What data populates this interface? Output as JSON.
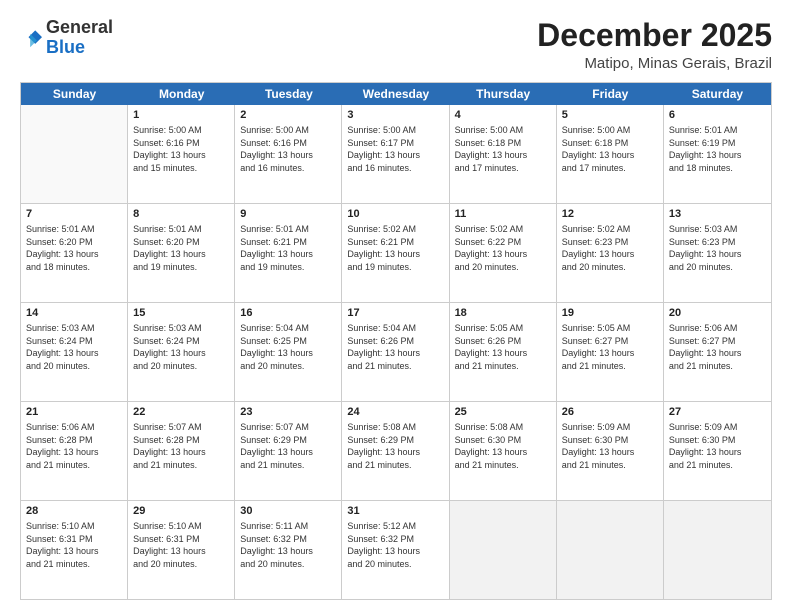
{
  "header": {
    "logo": {
      "general": "General",
      "blue": "Blue"
    },
    "title": "December 2025",
    "subtitle": "Matipo, Minas Gerais, Brazil"
  },
  "weekdays": [
    "Sunday",
    "Monday",
    "Tuesday",
    "Wednesday",
    "Thursday",
    "Friday",
    "Saturday"
  ],
  "rows": [
    [
      {
        "day": "",
        "info": "",
        "empty": true
      },
      {
        "day": "1",
        "info": "Sunrise: 5:00 AM\nSunset: 6:16 PM\nDaylight: 13 hours\nand 15 minutes."
      },
      {
        "day": "2",
        "info": "Sunrise: 5:00 AM\nSunset: 6:16 PM\nDaylight: 13 hours\nand 16 minutes."
      },
      {
        "day": "3",
        "info": "Sunrise: 5:00 AM\nSunset: 6:17 PM\nDaylight: 13 hours\nand 16 minutes."
      },
      {
        "day": "4",
        "info": "Sunrise: 5:00 AM\nSunset: 6:18 PM\nDaylight: 13 hours\nand 17 minutes."
      },
      {
        "day": "5",
        "info": "Sunrise: 5:00 AM\nSunset: 6:18 PM\nDaylight: 13 hours\nand 17 minutes."
      },
      {
        "day": "6",
        "info": "Sunrise: 5:01 AM\nSunset: 6:19 PM\nDaylight: 13 hours\nand 18 minutes."
      }
    ],
    [
      {
        "day": "7",
        "info": "Sunrise: 5:01 AM\nSunset: 6:20 PM\nDaylight: 13 hours\nand 18 minutes."
      },
      {
        "day": "8",
        "info": "Sunrise: 5:01 AM\nSunset: 6:20 PM\nDaylight: 13 hours\nand 19 minutes."
      },
      {
        "day": "9",
        "info": "Sunrise: 5:01 AM\nSunset: 6:21 PM\nDaylight: 13 hours\nand 19 minutes."
      },
      {
        "day": "10",
        "info": "Sunrise: 5:02 AM\nSunset: 6:21 PM\nDaylight: 13 hours\nand 19 minutes."
      },
      {
        "day": "11",
        "info": "Sunrise: 5:02 AM\nSunset: 6:22 PM\nDaylight: 13 hours\nand 20 minutes."
      },
      {
        "day": "12",
        "info": "Sunrise: 5:02 AM\nSunset: 6:23 PM\nDaylight: 13 hours\nand 20 minutes."
      },
      {
        "day": "13",
        "info": "Sunrise: 5:03 AM\nSunset: 6:23 PM\nDaylight: 13 hours\nand 20 minutes."
      }
    ],
    [
      {
        "day": "14",
        "info": "Sunrise: 5:03 AM\nSunset: 6:24 PM\nDaylight: 13 hours\nand 20 minutes."
      },
      {
        "day": "15",
        "info": "Sunrise: 5:03 AM\nSunset: 6:24 PM\nDaylight: 13 hours\nand 20 minutes."
      },
      {
        "day": "16",
        "info": "Sunrise: 5:04 AM\nSunset: 6:25 PM\nDaylight: 13 hours\nand 20 minutes."
      },
      {
        "day": "17",
        "info": "Sunrise: 5:04 AM\nSunset: 6:26 PM\nDaylight: 13 hours\nand 21 minutes."
      },
      {
        "day": "18",
        "info": "Sunrise: 5:05 AM\nSunset: 6:26 PM\nDaylight: 13 hours\nand 21 minutes."
      },
      {
        "day": "19",
        "info": "Sunrise: 5:05 AM\nSunset: 6:27 PM\nDaylight: 13 hours\nand 21 minutes."
      },
      {
        "day": "20",
        "info": "Sunrise: 5:06 AM\nSunset: 6:27 PM\nDaylight: 13 hours\nand 21 minutes."
      }
    ],
    [
      {
        "day": "21",
        "info": "Sunrise: 5:06 AM\nSunset: 6:28 PM\nDaylight: 13 hours\nand 21 minutes."
      },
      {
        "day": "22",
        "info": "Sunrise: 5:07 AM\nSunset: 6:28 PM\nDaylight: 13 hours\nand 21 minutes."
      },
      {
        "day": "23",
        "info": "Sunrise: 5:07 AM\nSunset: 6:29 PM\nDaylight: 13 hours\nand 21 minutes."
      },
      {
        "day": "24",
        "info": "Sunrise: 5:08 AM\nSunset: 6:29 PM\nDaylight: 13 hours\nand 21 minutes."
      },
      {
        "day": "25",
        "info": "Sunrise: 5:08 AM\nSunset: 6:30 PM\nDaylight: 13 hours\nand 21 minutes."
      },
      {
        "day": "26",
        "info": "Sunrise: 5:09 AM\nSunset: 6:30 PM\nDaylight: 13 hours\nand 21 minutes."
      },
      {
        "day": "27",
        "info": "Sunrise: 5:09 AM\nSunset: 6:30 PM\nDaylight: 13 hours\nand 21 minutes."
      }
    ],
    [
      {
        "day": "28",
        "info": "Sunrise: 5:10 AM\nSunset: 6:31 PM\nDaylight: 13 hours\nand 21 minutes."
      },
      {
        "day": "29",
        "info": "Sunrise: 5:10 AM\nSunset: 6:31 PM\nDaylight: 13 hours\nand 20 minutes."
      },
      {
        "day": "30",
        "info": "Sunrise: 5:11 AM\nSunset: 6:32 PM\nDaylight: 13 hours\nand 20 minutes."
      },
      {
        "day": "31",
        "info": "Sunrise: 5:12 AM\nSunset: 6:32 PM\nDaylight: 13 hours\nand 20 minutes."
      },
      {
        "day": "",
        "info": "",
        "empty": true,
        "shaded": true
      },
      {
        "day": "",
        "info": "",
        "empty": true,
        "shaded": true
      },
      {
        "day": "",
        "info": "",
        "empty": true,
        "shaded": true
      }
    ]
  ]
}
